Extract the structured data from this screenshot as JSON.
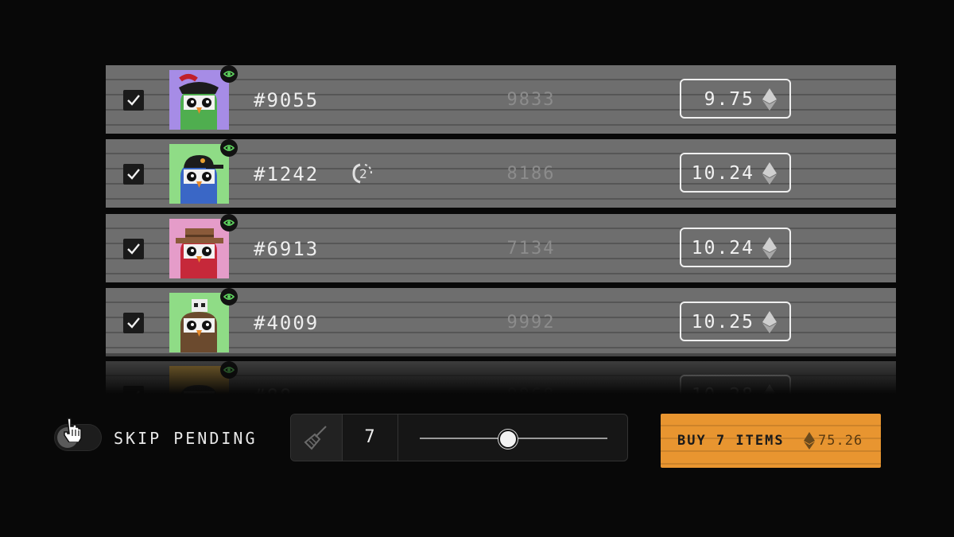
{
  "items": [
    {
      "id": "#9055",
      "rarity": "9833",
      "price": "9.75",
      "pending": "",
      "avatar_bg": "#a68ce6",
      "body_color": "#4fae4f",
      "hat": "pirate"
    },
    {
      "id": "#1242",
      "rarity": "8186",
      "price": "10.24",
      "pending": "2",
      "avatar_bg": "#8fdc86",
      "body_color": "#3a67c6",
      "hat": "cap"
    },
    {
      "id": "#6913",
      "rarity": "7134",
      "price": "10.24",
      "pending": "",
      "avatar_bg": "#e59cc9",
      "body_color": "#c6283a",
      "hat": "cowboy"
    },
    {
      "id": "#4009",
      "rarity": "9992",
      "price": "10.25",
      "pending": "",
      "avatar_bg": "#8fdc86",
      "body_color": "#6b4a2e",
      "hat": "skull"
    },
    {
      "id": "#88",
      "rarity": "8868",
      "price": "10.28",
      "pending": "",
      "avatar_bg": "#d4a84a",
      "body_color": "#3a3a3a",
      "hat": "none"
    }
  ],
  "controls": {
    "skip_pending_label": "SKIP PENDING",
    "sweep_count": "7",
    "buy_label": "BUY 7 ITEMS",
    "buy_total": "75.26",
    "slider_value": 0.47
  },
  "colors": {
    "row_bg": "#6e6e6e",
    "accent": "#e89530",
    "verified_badge": "#5fd35f"
  },
  "icons": [
    "checkbox-checked-icon",
    "verified-eye-icon",
    "pending-icon",
    "eth-icon",
    "broom-icon",
    "hand-cursor-icon"
  ]
}
